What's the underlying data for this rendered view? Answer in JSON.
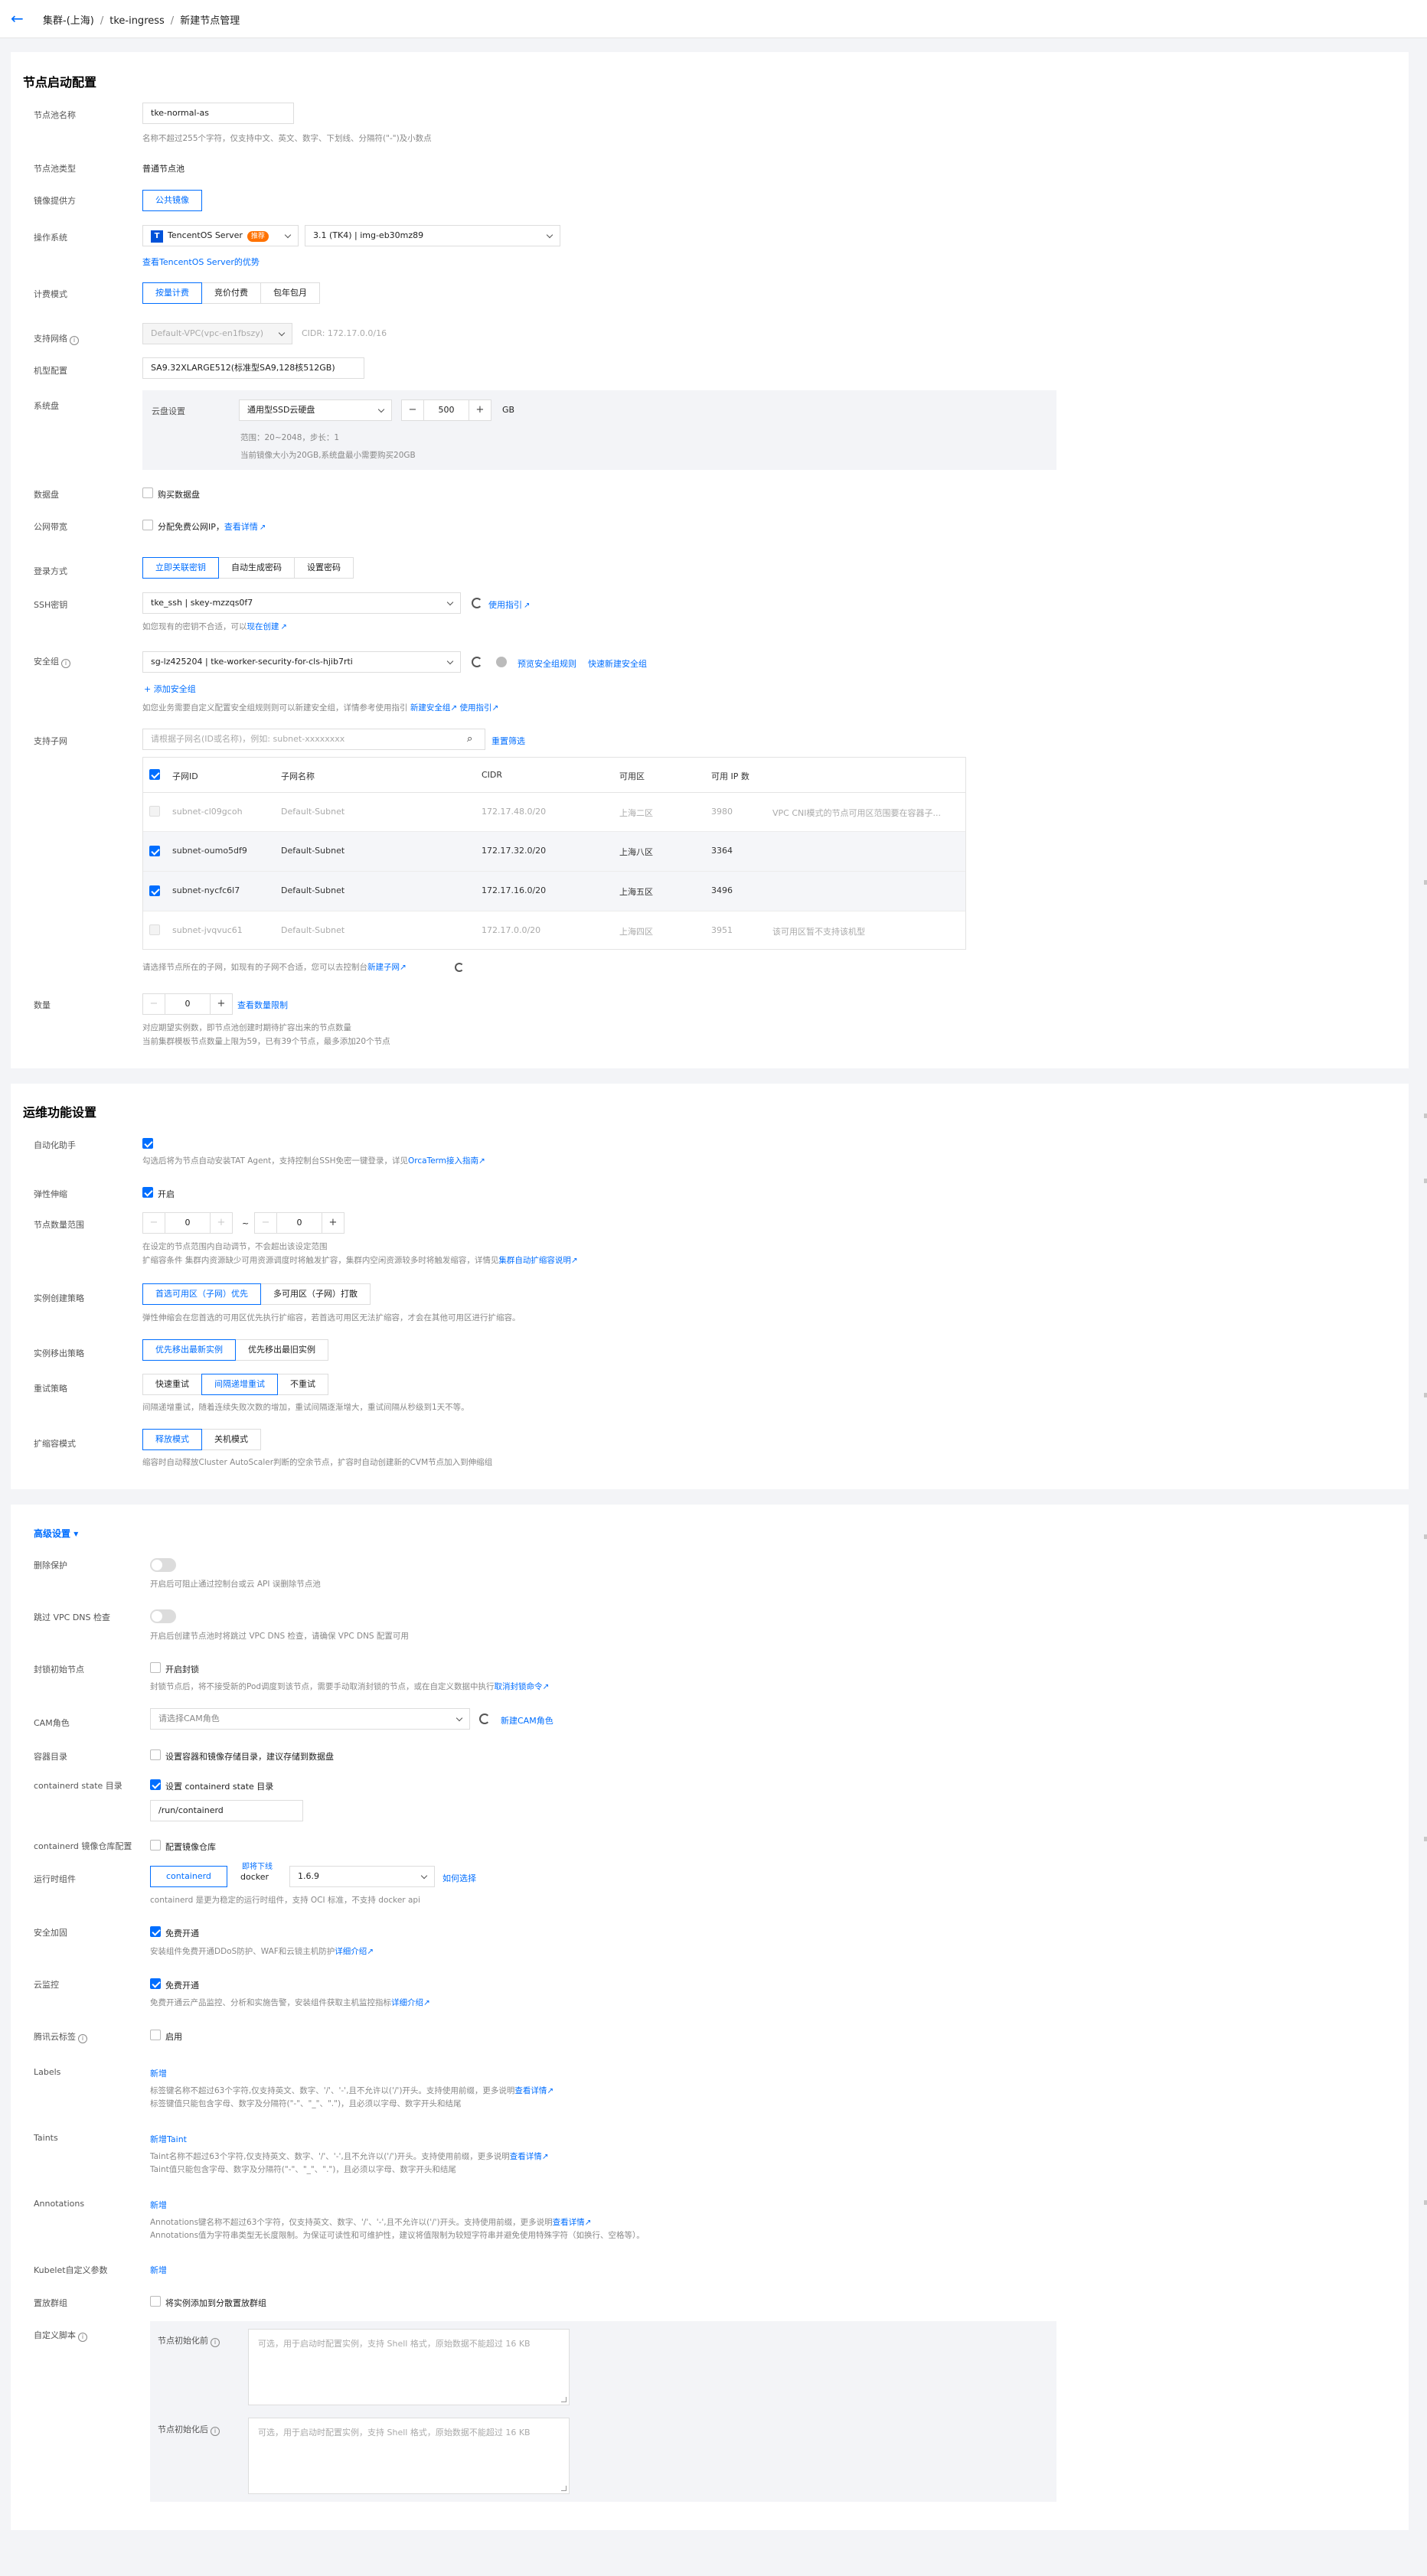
{
  "breadcrumb": {
    "back": "←",
    "items": [
      "集群-(上海)",
      "tke-ingress",
      "新建节点管理"
    ],
    "sep": "/"
  },
  "section1": {
    "title": "节点启动配置",
    "pool_name": {
      "label": "节点池名称",
      "value": "tke-normal-as",
      "help": "名称不超过255个字符，仅支持中文、英文、数字、下划线、分隔符(\"-\")及小数点"
    },
    "pool_type": {
      "label": "节点池类型",
      "value": "普通节点池"
    },
    "image_provider": {
      "label": "镜像提供方",
      "value": "公共镜像"
    },
    "os": {
      "label": "操作系统",
      "os_name": "TencentOS Server",
      "badge": "推荐",
      "version": "3.1 (TK4) | img-eb30mz89",
      "link": "查看TencentOS Server的优势"
    },
    "billing": {
      "label": "计费模式",
      "options": [
        "按量计费",
        "竞价付费",
        "包年包月"
      ]
    },
    "vpc": {
      "label": "支持网络",
      "value": "Default-VPC(vpc-en1fbszy)",
      "cidr": "CIDR: 172.17.0.0/16"
    },
    "model": {
      "label": "机型配置",
      "value": "SA9.32XLARGE512(标准型SA9,128核512GB)"
    },
    "system_disk": {
      "label": "系统盘",
      "sub_label": "云盘设置",
      "disk_type": "通用型SSD云硬盘",
      "minus": "−",
      "size": "500",
      "plus": "+",
      "unit": "GB",
      "range": "范围：20~2048，步长：1",
      "note": "当前镜像大小为20GB,系统盘最小需要购买20GB"
    },
    "data_disk": {
      "label": "数据盘",
      "text": "购买数据盘"
    },
    "public_bw": {
      "label": "公网带宽",
      "text": "分配免费公网IP，",
      "link": "查看详情"
    },
    "login": {
      "label": "登录方式",
      "options": [
        "立即关联密钥",
        "自动生成密码",
        "设置密码"
      ]
    },
    "ssh": {
      "label": "SSH密钥",
      "value": "tke_ssh | skey-mzzqs0f7",
      "guide": "使用指引",
      "help": "如您现有的密钥不合适，可以",
      "help_link": "现在创建"
    },
    "sg": {
      "label": "安全组",
      "value": "sg-lz425204 | tke-worker-security-for-cls-hjib7rti",
      "preview": "预览安全组规则",
      "quick": "快速新建安全组",
      "add": "添加安全组",
      "help": "如您业务需要自定义配置安全组规则则可以新建安全组，详情参考使用指引",
      "help_link1": "新建安全组",
      "help_link2": "使用指引"
    },
    "subnet": {
      "label": "支持子网",
      "search_ph": "请根据子网名(ID或名称)，例如: subnet-xxxxxxxx",
      "reset": "重置筛选",
      "headers": [
        "子网ID",
        "子网名称",
        "CIDR",
        "可用区",
        "可用 IP 数"
      ],
      "rows": [
        {
          "id": "subnet-cl09gcoh",
          "name": "Default-Subnet",
          "cidr": "172.17.48.0/20",
          "zone": "上海二区",
          "ips": "3980",
          "note": "VPC CNI模式的节点可用区范围要在容器子..."
        },
        {
          "id": "subnet-oumo5df9",
          "name": "Default-Subnet",
          "cidr": "172.17.32.0/20",
          "zone": "上海八区",
          "ips": "3364",
          "note": ""
        },
        {
          "id": "subnet-nycfc6l7",
          "name": "Default-Subnet",
          "cidr": "172.17.16.0/20",
          "zone": "上海五区",
          "ips": "3496",
          "note": ""
        },
        {
          "id": "subnet-jvqvuc61",
          "name": "Default-Subnet",
          "cidr": "172.17.0.0/20",
          "zone": "上海四区",
          "ips": "3951",
          "note": "该可用区暂不支持该机型"
        }
      ],
      "help": "请选择节点所在的子网，如现有的子网不合适，您可以去控制台",
      "help_link": "新建子网"
    },
    "count": {
      "label": "数量",
      "minus": "−",
      "value": "0",
      "plus": "+",
      "link": "查看数量限制",
      "help1": "对应期望实例数，即节点池创建时期待扩容出来的节点数量",
      "help2": "当前集群模板节点数量上限为59，已有39个节点，最多添加20个节点"
    }
  },
  "section2": {
    "title": "运维功能设置",
    "auto_assist": {
      "label": "自动化助手",
      "help": "勾选后将为节点自动安装TAT Agent，支持控制台SSH免密一键登录，详见",
      "link": "OrcaTerm接入指南"
    },
    "elastic": {
      "label": "弹性伸缩",
      "text": "开启"
    },
    "range": {
      "label": "节点数量范围",
      "min": "0",
      "max": "0",
      "dash": "~",
      "help1": "在设定的节点范围内自动调节，不会超出该设定范围",
      "help2": "扩缩容条件 集群内资源缺少可用资源调度时将触发扩容，集群内空闲资源较多时将触发缩容，详情见",
      "link": "集群自动扩缩容说明"
    },
    "create_policy": {
      "label": "实例创建策略",
      "options": [
        "首选可用区（子网）优先",
        "多可用区（子网）打散"
      ],
      "help": "弹性伸缩会在您首选的可用区优先执行扩缩容，若首选可用区无法扩缩容，才会在其他可用区进行扩缩容。"
    },
    "remove_policy": {
      "label": "实例移出策略",
      "options": [
        "优先移出最新实例",
        "优先移出最旧实例"
      ]
    },
    "retry": {
      "label": "重试策略",
      "options": [
        "快速重试",
        "间隔递增重试",
        "不重试"
      ],
      "help": "间隔递增重试，随着连续失败次数的增加，重试间隔逐渐增大，重试间隔从秒级到1天不等。"
    },
    "scale_mode": {
      "label": "扩缩容模式",
      "options": [
        "释放模式",
        "关机模式"
      ],
      "help": "缩容时自动释放Cluster AutoScaler判断的空余节点，扩容时自动创建新的CVM节点加入到伸缩组"
    }
  },
  "section3": {
    "title": "高级设置",
    "delete_protect": {
      "label": "删除保护",
      "help": "开启后可阻止通过控制台或云 API 误删除节点池"
    },
    "skip_dns": {
      "label": "跳过 VPC DNS 检查",
      "help": "开启后创建节点池时将跳过 VPC DNS 检查，请确保 VPC DNS 配置可用"
    },
    "cordon": {
      "label": "封锁初始节点",
      "text": "开启封锁",
      "help": "封锁节点后，将不接受新的Pod调度到该节点，需要手动取消封锁的节点，或在自定义数据中执行",
      "link": "取消封锁命令"
    },
    "cam": {
      "label": "CAM角色",
      "placeholder": "请选择CAM角色",
      "link": "新建CAM角色"
    },
    "container_dir": {
      "label": "容器目录",
      "text": "设置容器和镜像存储目录，建议存储到数据盘"
    },
    "containerd_state": {
      "label": "containerd state 目录",
      "text": "设置 containerd state 目录",
      "value": "/run/containerd"
    },
    "registry": {
      "label": "containerd 镜像仓库配置",
      "text": "配置镜像仓库"
    },
    "runtime": {
      "label": "运行时组件",
      "active": "containerd",
      "soon": "即将下线",
      "docker": "docker",
      "version": "1.6.9",
      "link": "如何选择",
      "help": "containerd 是更为稳定的运行时组件，支持 OCI 标准，不支持 docker api"
    },
    "security": {
      "label": "安全加固",
      "text": "免费开通",
      "help": "安装组件免费开通DDoS防护、WAF和云镜主机防护",
      "link": "详细介绍"
    },
    "monitor": {
      "label": "云监控",
      "text": "免费开通",
      "help": "免费开通云产品监控、分析和实施告警，安装组件获取主机监控指标",
      "link": "详细介绍"
    },
    "tag": {
      "label": "腾讯云标签",
      "text": "启用"
    },
    "labels": {
      "label": "Labels",
      "add": "新增",
      "help1": "标签键名称不超过63个字符,仅支持英文、数字、'/'、'-',且不允许以('/')开头。支持使用前缀，更多说明",
      "link": "查看详情",
      "help2": "标签键值只能包含字母、数字及分隔符(\"-\"、\"_\"、\".\")，且必须以字母、数字开头和结尾"
    },
    "taints": {
      "label": "Taints",
      "add": "新增Taint",
      "help1": "Taint名称不超过63个字符,仅支持英文、数字、'/'、'-',且不允许以('/')开头。支持使用前缀，更多说明",
      "link": "查看详情",
      "help2": "Taint值只能包含字母、数字及分隔符(\"-\"、\"_\"、\".\")，且必须以字母、数字开头和结尾"
    },
    "annotations": {
      "label": "Annotations",
      "add": "新增",
      "help1": "Annotations键名称不超过63个字符，仅支持英文、数字、'/'、'-',且不允许以('/')开头。支持使用前缀，更多说明",
      "link": "查看详情",
      "help2": "Annotations值为字符串类型无长度限制。为保证可读性和可维护性，建议将值限制为较短字符串并避免使用特殊字符（如换行、空格等）。"
    },
    "kubelet": {
      "label": "Kubelet自定义参数",
      "add": "新增"
    },
    "placement": {
      "label": "置放群组",
      "text": "将实例添加到分散置放群组"
    },
    "script": {
      "label": "自定义脚本",
      "before": "节点初始化前",
      "after": "节点初始化后",
      "ph": "可选，用于启动时配置实例，支持 Shell 格式，原始数据不能超过 16 KB"
    }
  }
}
